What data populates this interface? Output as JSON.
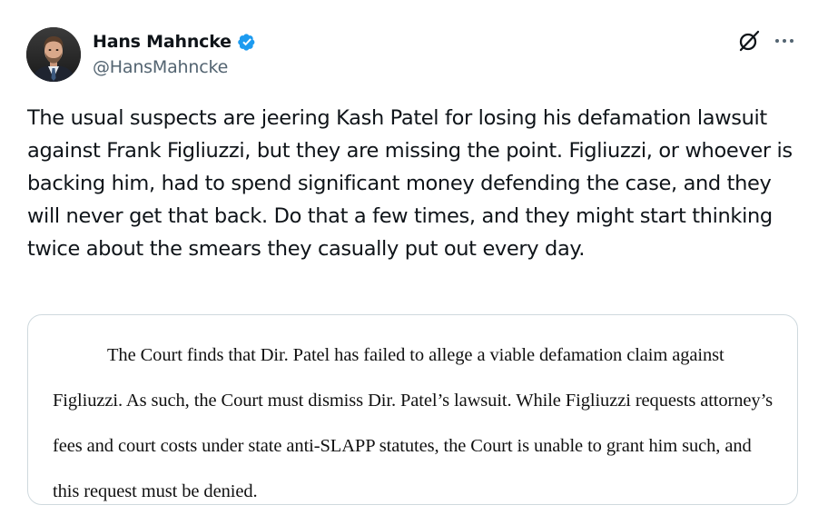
{
  "author": {
    "name": "Hans Mahncke",
    "handle": "@HansMahncke",
    "verified_color": "#1d9bf0"
  },
  "header_actions": {
    "grok_icon": "grok-icon",
    "more_icon": "more-dots-icon"
  },
  "tweet": {
    "text": "The usual suspects are jeering Kash Patel for losing his defamation lawsuit against Frank Figliuzzi, but they are missing the point. Figliuzzi, or whoever is backing him, had to spend significant money defending the case, and they will never get that back. Do that a few times, and they might start thinking twice about the smears they casually put out every day."
  },
  "media": {
    "document_text": "The Court finds that Dir. Patel has failed to allege a viable defamation claim against Figliuzzi. As such, the Court must dismiss Dir. Patel’s lawsuit. While Figliuzzi requests attorney’s fees and court costs under state anti-SLAPP statutes, the Court is unable to grant him such, and this request must be denied."
  }
}
